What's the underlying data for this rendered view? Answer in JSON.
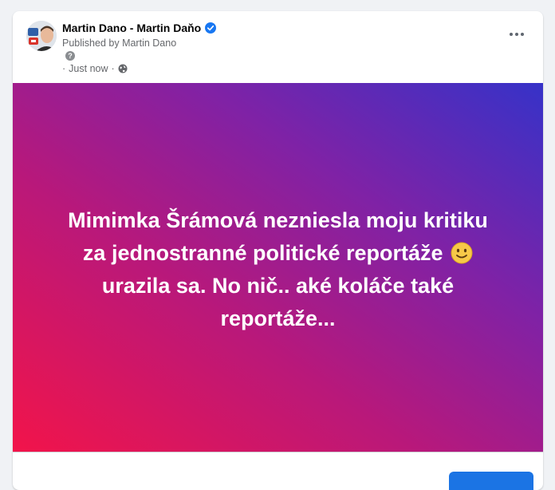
{
  "post": {
    "author": "Martin Dano - Martin Daňo",
    "published_prefix": "Published by",
    "published_by": "Martin Dano",
    "help_glyph": "?",
    "time": "Just now",
    "time_separator": "·",
    "audience_icon": "globe-icon",
    "verified_icon": "verified-badge-icon",
    "more_icon": "more-horizontal-icon",
    "text_line_1": "Mimimka Šrámová nezniesla moju kritiku",
    "text_line_2": "za jednostranné politické reportáže",
    "text_line_3": "urazila sa. No nič.. aké koláče také",
    "text_line_4": "reportáže...",
    "emoji": "slightly-smiling-face-emoji",
    "background_gradient": [
      "#f2144a",
      "#b9187a",
      "#7f22a6",
      "#3632c8"
    ]
  },
  "colors": {
    "accent": "#1b74e4",
    "verified": "#1877f2",
    "secondary_text": "#65676b"
  }
}
